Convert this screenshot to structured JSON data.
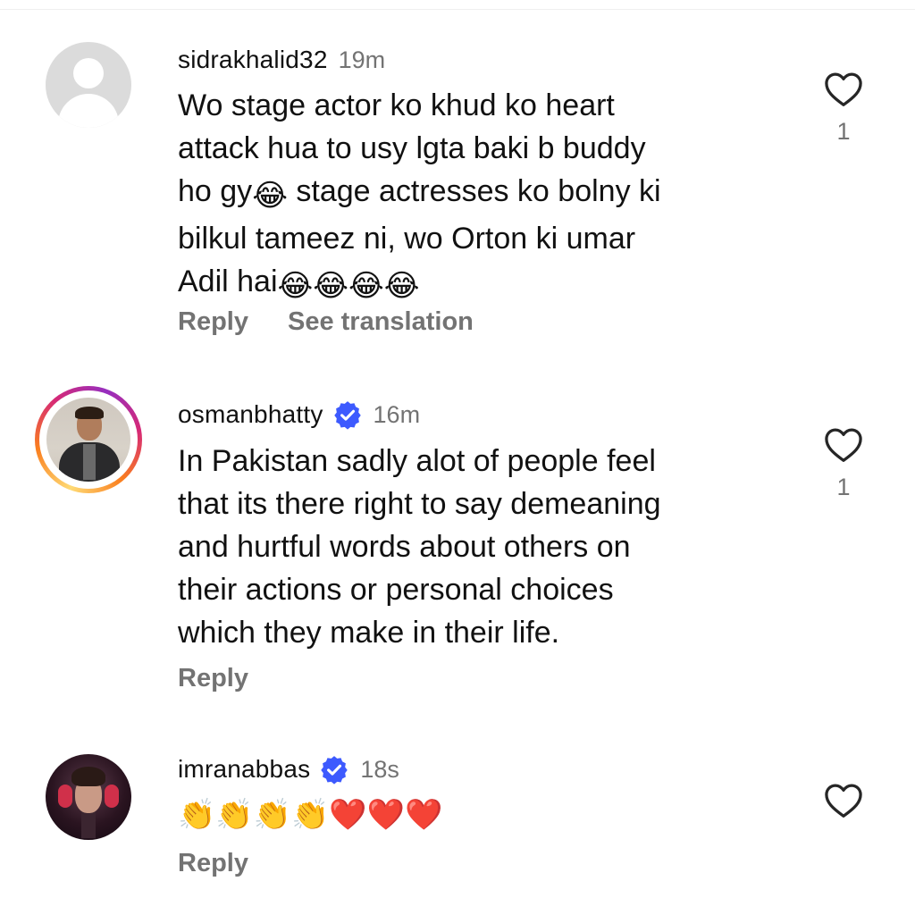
{
  "comments": [
    {
      "username": "sidrakhalid32",
      "time": "19m",
      "verified": false,
      "text_main": "Wo stage actor ko khud ko heart\nattack hua to usy lgta baki b buddy\nho gy",
      "emoji_a": "😂",
      "text_after_emoji": " stage actresses ko bolny ki\nbilkul tameez ni, wo Orton ki umar\nAdil hai",
      "emoji_b": "😂😂😂😂",
      "reply": "Reply",
      "see_translation": "See translation",
      "likes": "1"
    },
    {
      "username": "osmanbhatty",
      "time": "16m",
      "verified": true,
      "text": "In Pakistan sadly alot of people feel\nthat its there right to say demeaning\nand hurtful words about others on\ntheir actions or personal choices\nwhich they make in their life.",
      "reply": "Reply",
      "likes": "1"
    },
    {
      "username": "imranabbas",
      "time": "18s",
      "verified": true,
      "text": "👏👏👏👏❤️❤️❤️",
      "reply": "Reply",
      "likes": ""
    }
  ],
  "colors": {
    "secondary_text": "#737373",
    "verified_blue": "#3d5afe",
    "placeholder_avatar": "#dbdbdb"
  },
  "icons": {
    "like": "heart-outline-icon",
    "verified": "verified-badge-icon"
  }
}
